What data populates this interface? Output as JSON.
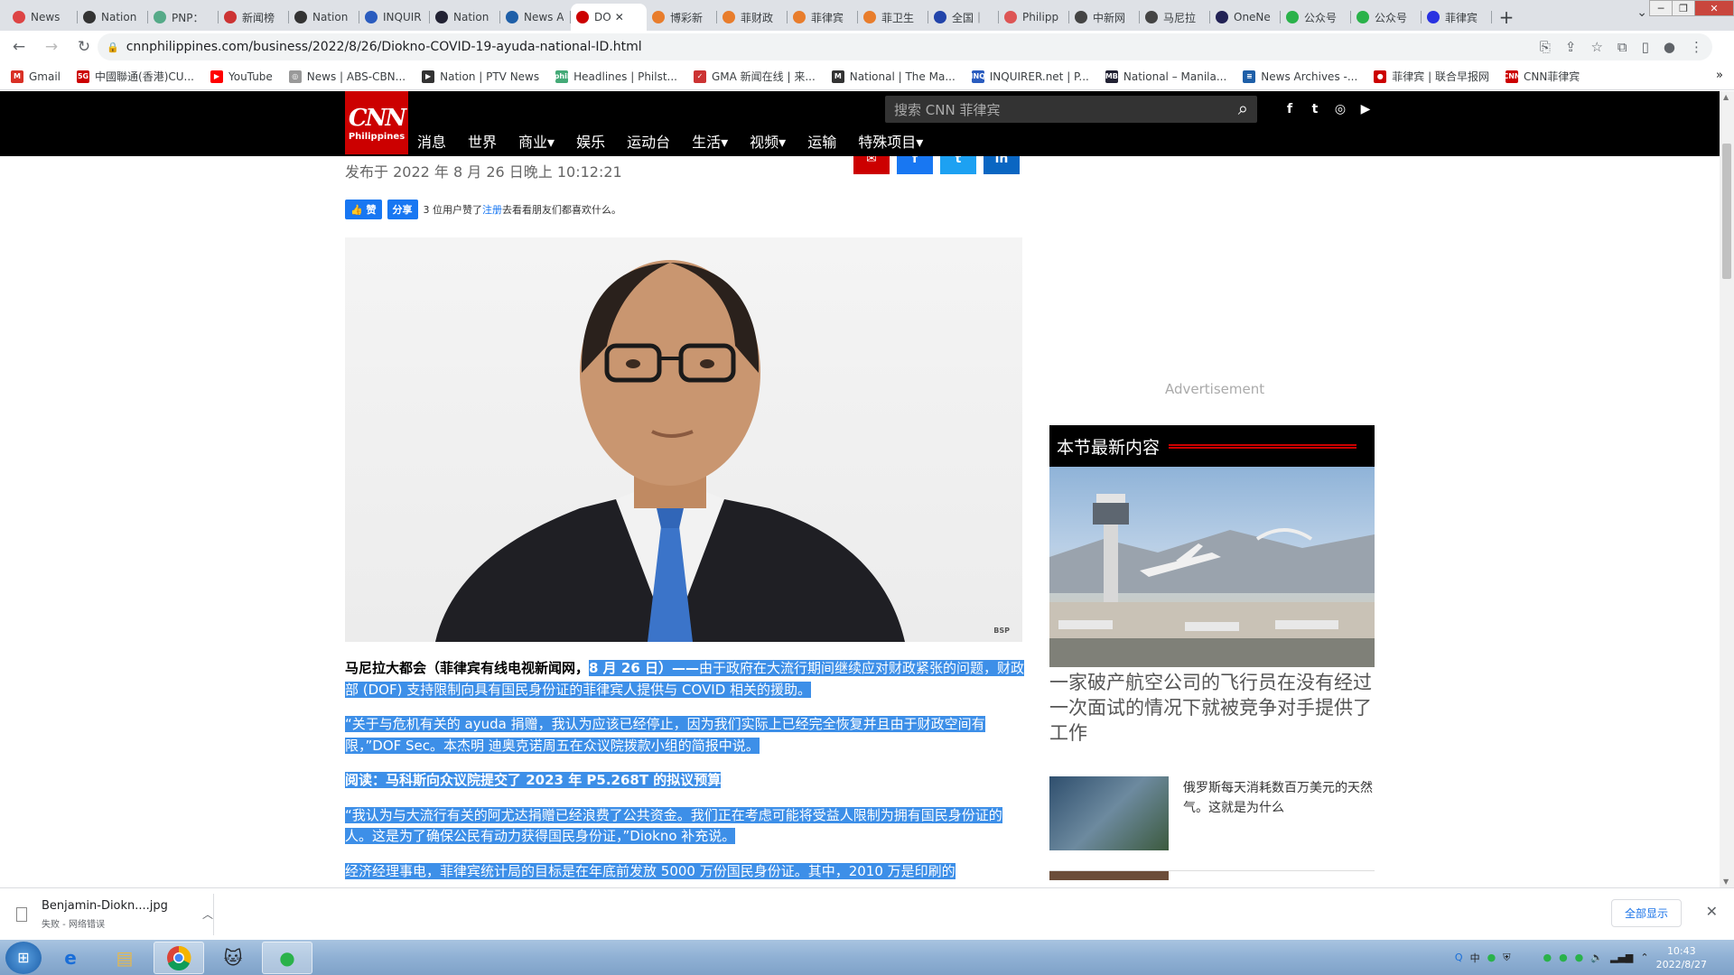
{
  "browser": {
    "tabs": [
      {
        "label": "News",
        "color": "#d44"
      },
      {
        "label": "Nation",
        "color": "#333"
      },
      {
        "label": "PNP：",
        "color": "#5a8"
      },
      {
        "label": "新闻榜",
        "color": "#c33"
      },
      {
        "label": "Nation",
        "color": "#333"
      },
      {
        "label": "INQUIR",
        "color": "#2a5cbf"
      },
      {
        "label": "Nation",
        "color": "#223"
      },
      {
        "label": "News A",
        "color": "#1e5fa8"
      },
      {
        "label": "DO",
        "color": "#c00",
        "active": true
      },
      {
        "label": "博彩新",
        "color": "#e87d2c"
      },
      {
        "label": "菲财政",
        "color": "#e87d2c"
      },
      {
        "label": "菲律宾",
        "color": "#e87d2c"
      },
      {
        "label": "菲卫生",
        "color": "#e87d2c"
      },
      {
        "label": "全国｜",
        "color": "#2244aa"
      },
      {
        "label": "Philipp",
        "color": "#d55"
      },
      {
        "label": "中新网",
        "color": "#444"
      },
      {
        "label": "马尼拉",
        "color": "#444"
      },
      {
        "label": "OneNe",
        "color": "#225"
      },
      {
        "label": "公众号",
        "color": "#2ab24a"
      },
      {
        "label": "公众号",
        "color": "#2ab24a"
      },
      {
        "label": "菲律宾",
        "color": "#2932e1"
      }
    ],
    "url": "cnnphilippines.com/business/2022/8/26/Diokno-COVID-19-ayuda-national-ID.html",
    "bookmarks": [
      {
        "label": "Gmail",
        "color": "#d93025",
        "glyph": "M"
      },
      {
        "label": "中國聯通(香港)CU...",
        "color": "#c00",
        "glyph": "5G"
      },
      {
        "label": "YouTube",
        "color": "#f00",
        "glyph": "▶"
      },
      {
        "label": "News | ABS-CBN...",
        "color": "#999",
        "glyph": "◎"
      },
      {
        "label": "Nation | PTV News",
        "color": "#333",
        "glyph": "▶"
      },
      {
        "label": "Headlines | Philst...",
        "color": "#4a7",
        "glyph": "phil"
      },
      {
        "label": "GMA 新闻在线 | 来...",
        "color": "#c33",
        "glyph": "✓"
      },
      {
        "label": "National | The Ma...",
        "color": "#333",
        "glyph": "M"
      },
      {
        "label": "INQUIRER.net | P...",
        "color": "#2a5cbf",
        "glyph": "INQ"
      },
      {
        "label": "National – Manila...",
        "color": "#223",
        "glyph": "MB"
      },
      {
        "label": "News Archives -...",
        "color": "#1e5fa8",
        "glyph": "≡"
      },
      {
        "label": "菲律宾 | 联合早报网",
        "color": "#c00",
        "glyph": "●"
      },
      {
        "label": "CNN菲律宾",
        "color": "#c00",
        "glyph": "CNN"
      }
    ],
    "bookmarks_more": "»"
  },
  "site": {
    "logo_main": "CNN",
    "logo_sub": "Philippines",
    "search_placeholder": "搜索 CNN 菲律宾",
    "social": [
      "f",
      "t",
      "◎",
      "▶"
    ],
    "nav": [
      "消息",
      "世界",
      "商业▾",
      "娱乐",
      "运动台",
      "生活▾",
      "视频▾",
      "运输",
      "特殊项目▾"
    ]
  },
  "article": {
    "share_buttons": [
      {
        "label": "✉",
        "color": "#cc0000"
      },
      {
        "label": "f",
        "color": "#1877f2"
      },
      {
        "label": "t",
        "color": "#1da1f2"
      },
      {
        "label": "in",
        "color": "#0a66c2"
      }
    ],
    "published": "发布于 2022 年 8 月 26 日晚上 10:12:21",
    "fb_like": "👍 赞",
    "fb_share": "分享",
    "fb_text_before": "3 位用户赞了",
    "fb_link": "注册",
    "fb_text_after": "去看看朋友们都喜欢什么。",
    "photo_credit": "BSP",
    "p1_plain": "马尼拉大都会（菲律宾有线电视新闻网，",
    "p1_hl_bold": "8 月 26 日）——",
    "p1_hl": "由于政府在大流行期间继续应对财政紧张的问题，财政部 (DOF) 支持限制向具有国民身份证的菲律宾人提供与 COVID 相关的援助。",
    "p2": "“关于与危机有关的 ayuda 捐赠，我认为应该已经停止，因为我们实际上已经完全恢复并且由于财政空间有限，”DOF Sec。本杰明 迪奥克诺周五在众议院拨款小组的简报中说。",
    "p3": "阅读：马科斯向众议院提交了 2023 年 P5.268T 的拟议预算",
    "p4": "“我认为与大流行有关的阿尤达捐赠已经浪费了公共资金。我们正在考虑可能将受益人限制为拥有国民身份证的人。这是为了确保公民有动力获得国民身份证，”Diokno 补充说。",
    "p5": "经济经理事电，菲律宾统计局的目标是在年底前发放 5000 万份国民身份证。其中，2010 万是印刷的"
  },
  "sidebar": {
    "ad_label": "Advertisement",
    "section_title": "本节最新内容",
    "lead_title": "一家破产航空公司的飞行员在没有经过一次面试的情况下就被竞争对手提供了工作",
    "item1": "俄罗斯每天消耗数百万美元的天然气。这就是为什么"
  },
  "download": {
    "filename": "Benjamin-Diokn....jpg",
    "status": "失败 - 网络错误",
    "show_all": "全部显示",
    "close": "✕"
  },
  "taskbar": {
    "time": "10:43",
    "date": "2022/8/27",
    "tray_lang": "中"
  }
}
